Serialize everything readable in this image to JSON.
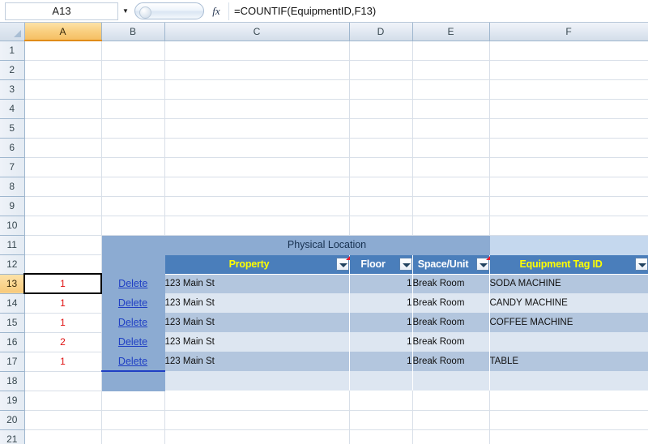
{
  "formula_bar": {
    "name_box_value": "A13",
    "name_box_arrow": "▼",
    "fx_label": "fx",
    "formula_value": "=COUNTIF(EquipmentID,F13)"
  },
  "grid": {
    "column_headers": [
      "A",
      "B",
      "C",
      "D",
      "E",
      "F"
    ],
    "selected_column": "A",
    "selected_row": "13",
    "selected_cell": "A13",
    "row_numbers": [
      "1",
      "2",
      "3",
      "4",
      "5",
      "6",
      "7",
      "8",
      "9",
      "10",
      "11",
      "12",
      "13",
      "14",
      "15",
      "16",
      "17",
      "18",
      "19",
      "20",
      "21"
    ]
  },
  "table": {
    "group_header": {
      "label": "Physical Location",
      "spans_columns": [
        "C",
        "D",
        "E"
      ]
    },
    "column_headers": [
      {
        "label": "Property",
        "column": "C",
        "color": "#ffff00",
        "has_filter": true,
        "has_comment": true
      },
      {
        "label": "Floor",
        "column": "D",
        "color": "#ffffff",
        "has_filter": true,
        "has_comment": false
      },
      {
        "label": "Space/Unit",
        "column": "E",
        "color": "#ffffff",
        "has_filter": true,
        "has_comment": true
      },
      {
        "label": "Equipment Tag ID",
        "column": "F",
        "color": "#ffff00",
        "has_filter": true,
        "has_comment": false
      }
    ],
    "delete_link_label": "Delete",
    "rows": [
      {
        "row": "13",
        "count": "1",
        "action": "Delete",
        "property": "123 Main St",
        "floor": "1",
        "space_unit": "Break Room",
        "equipment_tag_id": "SODA MACHINE"
      },
      {
        "row": "14",
        "count": "1",
        "action": "Delete",
        "property": "123 Main St",
        "floor": "1",
        "space_unit": "Break Room",
        "equipment_tag_id": "CANDY MACHINE"
      },
      {
        "row": "15",
        "count": "1",
        "action": "Delete",
        "property": "123 Main St",
        "floor": "1",
        "space_unit": "Break Room",
        "equipment_tag_id": "COFFEE MACHINE"
      },
      {
        "row": "16",
        "count": "2",
        "action": "Delete",
        "property": "123 Main St",
        "floor": "1",
        "space_unit": "Break Room",
        "equipment_tag_id": ""
      },
      {
        "row": "17",
        "count": "1",
        "action": "Delete",
        "property": "123 Main St",
        "floor": "1",
        "space_unit": "Break Room",
        "equipment_tag_id": "TABLE"
      }
    ]
  },
  "colors": {
    "header_band": "#4a7ebb",
    "group_band": "#8cabd2",
    "group_band_light": "#c5d8ee",
    "row_odd": "#b3c6de",
    "row_even": "#dde6f1",
    "link": "#1f3fc4",
    "count_text": "#e01010",
    "selected_header": "#f5bf63"
  }
}
